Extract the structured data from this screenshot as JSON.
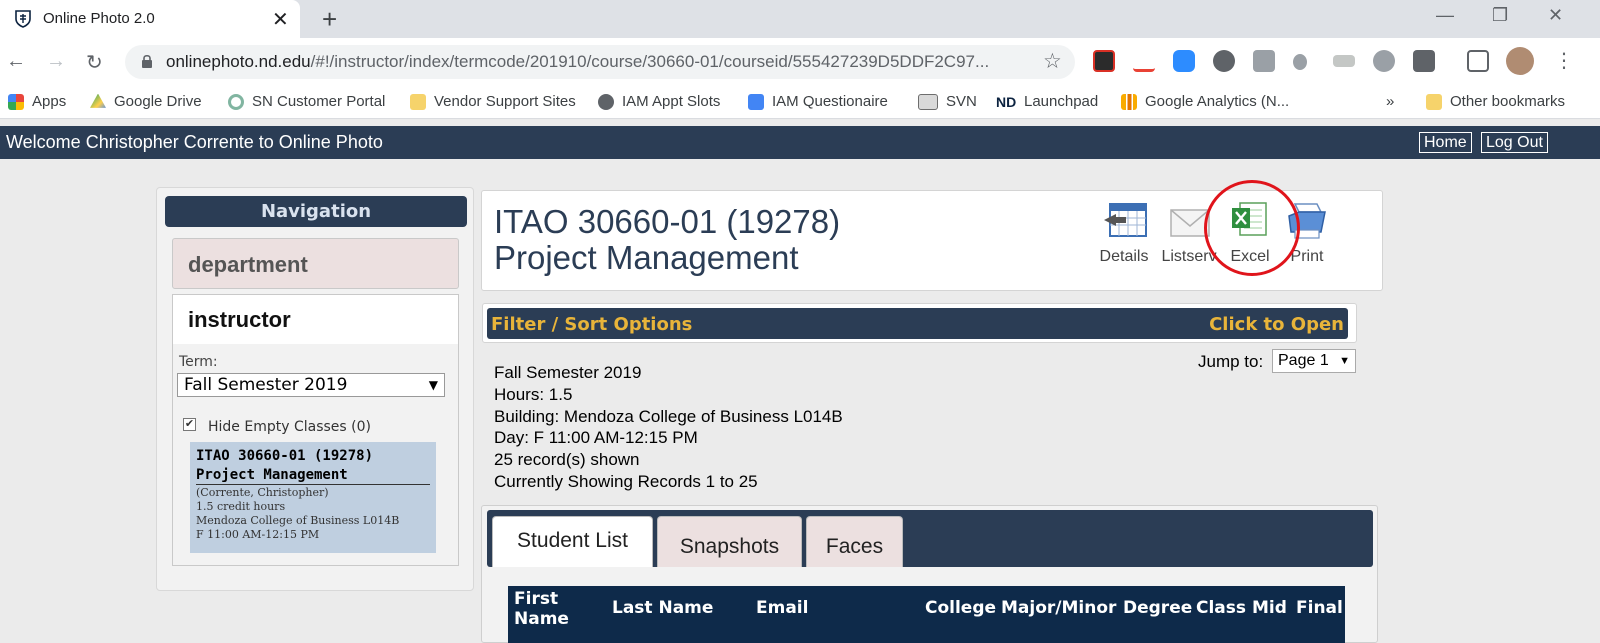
{
  "browser": {
    "tab_title": "Online Photo 2.0",
    "url_host": "onlinephoto.nd.edu",
    "url_path": "/#!/instructor/index/termcode/201910/course/30660-01/courseid/555427239D5DDF2C97...",
    "bookmarks": [
      {
        "label": "Apps",
        "icon": "apps-grid-icon",
        "color": "#e8453c"
      },
      {
        "label": "Google Drive",
        "icon": "google-drive-icon",
        "color": "#1fa463"
      },
      {
        "label": "SN Customer Portal",
        "icon": "servicenow-icon",
        "color": "#81b5a1"
      },
      {
        "label": "Vendor Support Sites",
        "icon": "folder-icon",
        "color": "#f6d36b"
      },
      {
        "label": "IAM Appt Slots",
        "icon": "globe-icon",
        "color": "#5f6368"
      },
      {
        "label": "IAM Questionaire",
        "icon": "google-docs-icon",
        "color": "#4285f4"
      },
      {
        "label": "SVN",
        "icon": "svn-icon",
        "color": "#6d6d6d"
      },
      {
        "label": "Launchpad",
        "icon": "notre-dame-icon",
        "color": "#0c2340"
      },
      {
        "label": "Google Analytics (N...",
        "icon": "analytics-icon",
        "color": "#f9ab00"
      },
      {
        "label": "Other bookmarks",
        "icon": "folder-icon",
        "color": "#f6d36b"
      }
    ],
    "overflow": "»"
  },
  "app": {
    "welcome": "Welcome Christopher Corrente to Online Photo",
    "home_label": "Home",
    "logout_label": "Log Out"
  },
  "nav": {
    "heading": "Navigation",
    "department": "department",
    "instructor": "instructor",
    "term_label": "Term:",
    "term_value": "Fall Semester 2019",
    "hide_empty": "Hide Empty Classes (0)",
    "card": {
      "title": "ITAO 30660-01 (19278)",
      "name": "Project Management",
      "instructor": "(Corrente, Christopher)",
      "credits": "1.5 credit hours",
      "building": "Mendoza College of Business L014B",
      "time": "F 11:00 AM-12:15 PM"
    }
  },
  "course": {
    "code": "ITAO 30660-01 (19278)",
    "name": "Project Management",
    "actions": {
      "details": "Details",
      "listserv": "Listserv",
      "excel": "Excel",
      "print": "Print"
    }
  },
  "filter": {
    "label": "Filter / Sort Options",
    "toggle": "Click to Open"
  },
  "info": {
    "term": "Fall Semester 2019",
    "hours": "Hours: 1.5",
    "building": "Building: Mendoza College of Business L014B",
    "day": "Day: F 11:00 AM-12:15 PM",
    "records": "25 record(s) shown",
    "showing": "Currently Showing Records 1 to 25"
  },
  "jump": {
    "label": "Jump to:",
    "value": "Page 1"
  },
  "tabs": {
    "student_list": "Student List",
    "snapshots": "Snapshots",
    "faces": "Faces"
  },
  "table": {
    "columns": {
      "first_name_1": "First",
      "first_name_2": "Name",
      "last_name": "Last Name",
      "email": "Email",
      "college": "College",
      "major": "Major/Minor",
      "degree": "Degree",
      "class": "Class",
      "mid": "Mid",
      "final": "Final"
    }
  },
  "colors": {
    "header_navy": "#2b3d55",
    "accent_gold": "#e8b43a",
    "highlight_red": "#e0141b"
  }
}
